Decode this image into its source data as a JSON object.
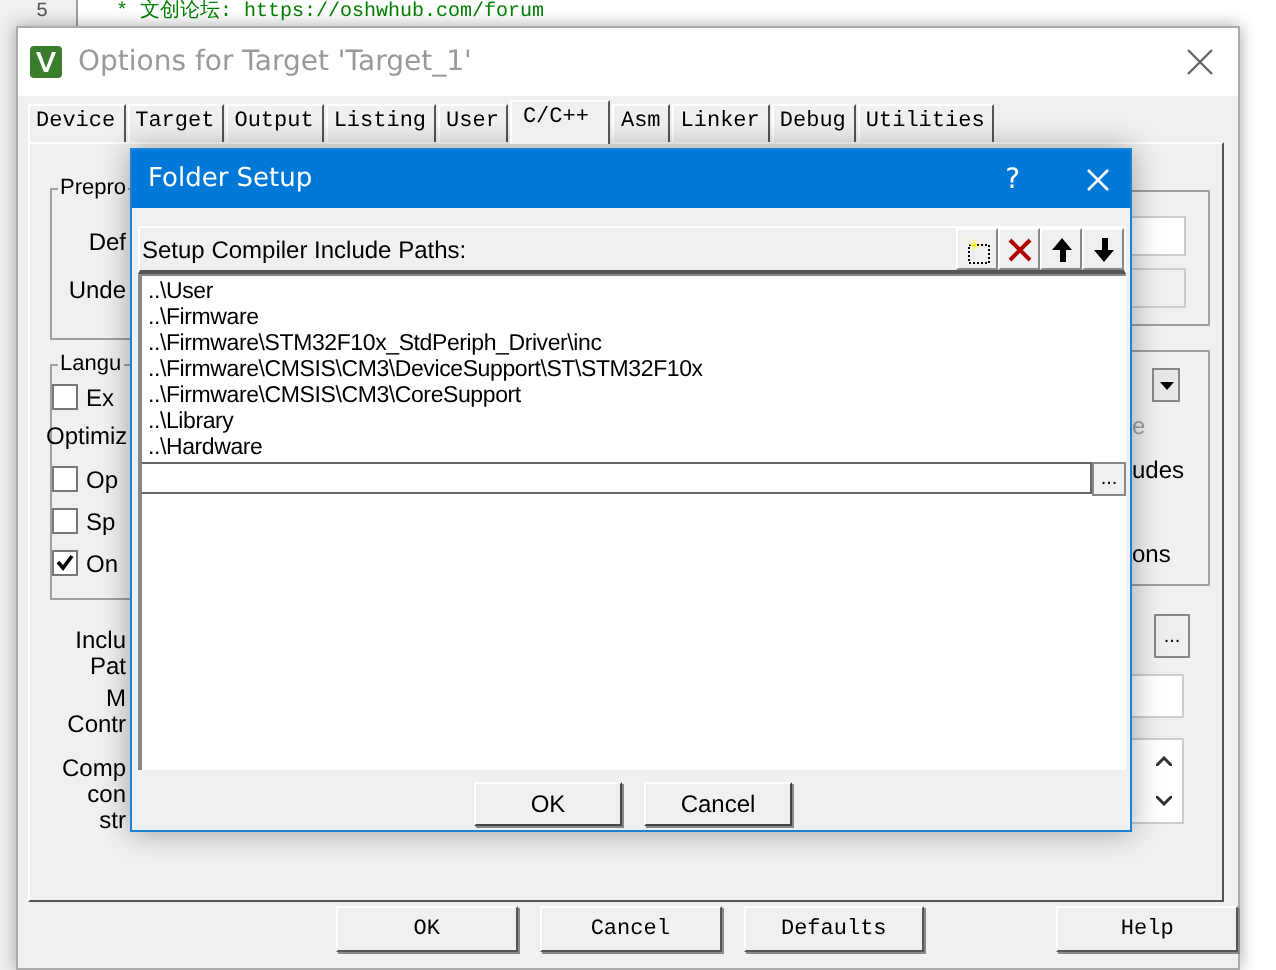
{
  "editor": {
    "line_number": "5",
    "comment": "* 文创论坛: https://oshwhub.com/forum"
  },
  "options": {
    "title": "Options for Target 'Target_1'",
    "tabs": [
      {
        "label": "Device",
        "selected": false
      },
      {
        "label": "Target",
        "selected": false
      },
      {
        "label": "Output",
        "selected": false
      },
      {
        "label": "Listing",
        "selected": false
      },
      {
        "label": "User",
        "selected": false
      },
      {
        "label": "C/C++",
        "selected": true
      },
      {
        "label": "Asm",
        "selected": false
      },
      {
        "label": "Linker",
        "selected": false
      },
      {
        "label": "Debug",
        "selected": false
      },
      {
        "label": "Utilities",
        "selected": false
      }
    ],
    "preprocessor": {
      "legend": "Prepro",
      "labels": [
        "Def",
        "Unde"
      ]
    },
    "language": {
      "legend": "Langu",
      "checkboxes": [
        {
          "label": "Ex",
          "checked": false
        }
      ],
      "optimization_label": "Optimiz",
      "options": [
        {
          "label": "Op",
          "checked": false
        },
        {
          "label": "Sp",
          "checked": false
        },
        {
          "label": "On",
          "checked": true
        }
      ],
      "right_labels": [
        {
          "text": "e",
          "disabled": true
        },
        {
          "text": "udes",
          "disabled": false
        },
        {
          "text": "ons",
          "disabled": false
        }
      ]
    },
    "lower_labels": [
      {
        "lines": [
          "Inclu",
          "Pat"
        ]
      },
      {
        "lines": [
          "M",
          "Contr"
        ]
      },
      {
        "lines": [
          "Comp",
          "con",
          "str"
        ]
      }
    ],
    "browse_button": "...",
    "buttons": [
      "OK",
      "Cancel",
      "Defaults",
      "Help"
    ]
  },
  "dialog": {
    "title": "Folder Setup",
    "help": "?",
    "label": "Setup Compiler Include Paths:",
    "paths": [
      "..\\User",
      "..\\Firmware",
      "..\\Firmware\\STM32F10x_StdPeriph_Driver\\inc",
      "..\\Firmware\\CMSIS\\CM3\\DeviceSupport\\ST\\STM32F10x",
      "..\\Firmware\\CMSIS\\CM3\\CoreSupport",
      "..\\Library",
      "..\\Hardware"
    ],
    "browse_button": "...",
    "buttons": [
      "OK",
      "Cancel"
    ]
  }
}
